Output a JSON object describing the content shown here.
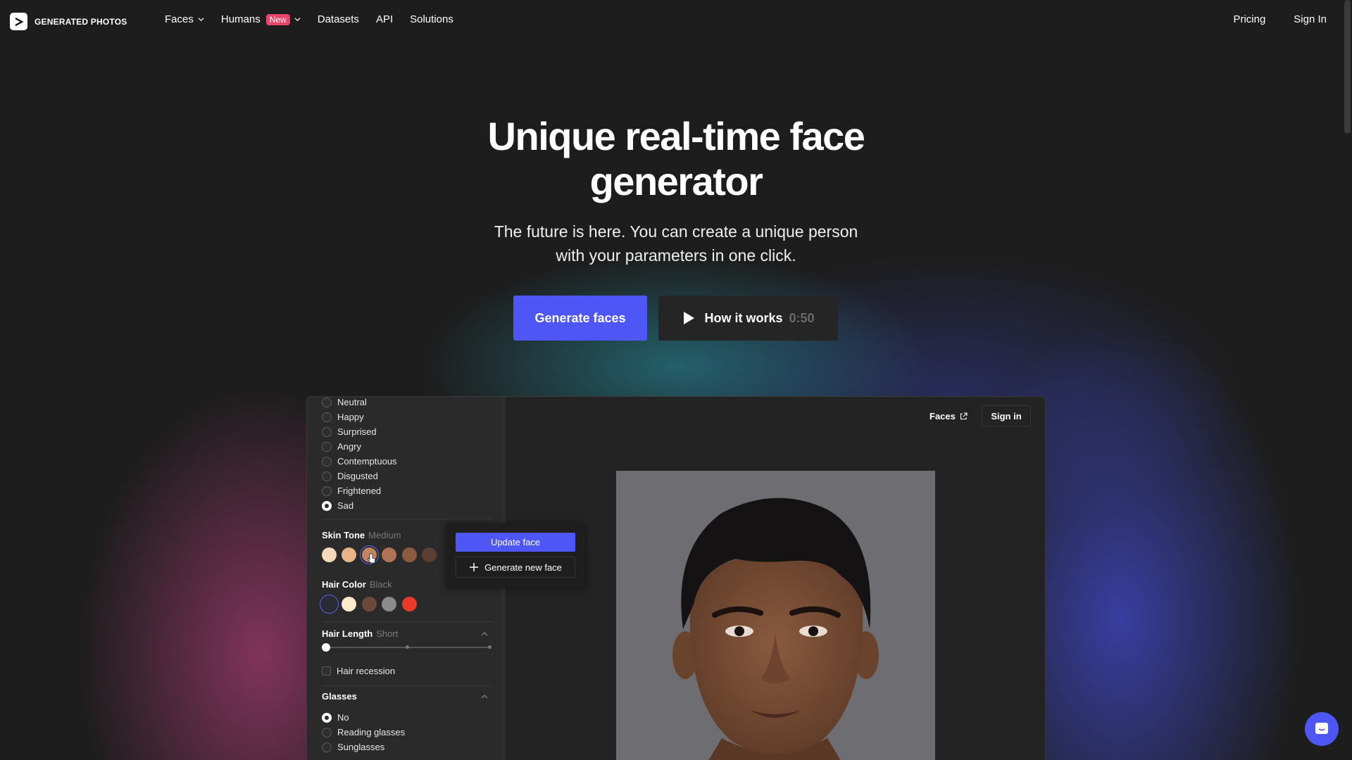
{
  "nav": {
    "brand": "GENERATED PHOTOS",
    "links": [
      {
        "label": "Faces",
        "dropdown": true
      },
      {
        "label": "Humans",
        "badge": "New",
        "dropdown": true
      },
      {
        "label": "Datasets"
      },
      {
        "label": "API"
      },
      {
        "label": "Solutions"
      }
    ],
    "pricing": "Pricing",
    "sign_in": "Sign In"
  },
  "hero": {
    "title_line1": "Unique real-time face",
    "title_line2": "generator",
    "subtitle_line1": "The future is here. You can create a unique person",
    "subtitle_line2": "with your parameters in one click.",
    "cta_primary": "Generate faces",
    "cta_secondary": "How it works",
    "video_duration": "0:50"
  },
  "app": {
    "emotions": [
      {
        "label": "Neutral",
        "selected": false
      },
      {
        "label": "Happy",
        "selected": false
      },
      {
        "label": "Surprised",
        "selected": false
      },
      {
        "label": "Angry",
        "selected": false
      },
      {
        "label": "Contemptuous",
        "selected": false
      },
      {
        "label": "Disgusted",
        "selected": false
      },
      {
        "label": "Frightened",
        "selected": false
      },
      {
        "label": "Sad",
        "selected": true
      }
    ],
    "skin_tone": {
      "label": "Skin Tone",
      "value": "Medium",
      "colors": [
        "#f3d9b8",
        "#e8b487",
        "#c38462",
        "#b07356",
        "#8d5a40",
        "#5c3f34"
      ],
      "selected_index": 2
    },
    "hair_color": {
      "label": "Hair Color",
      "value": "Black",
      "colors": [
        "#2b2b33",
        "#fbeacb",
        "#6b4a3c",
        "#8a8a8a",
        "#e8392b"
      ],
      "selected_index": 0
    },
    "hair_length": {
      "label": "Hair Length",
      "value": "Short",
      "level": 0
    },
    "hair_recession": "Hair recession",
    "glasses": {
      "label": "Glasses",
      "options": [
        {
          "label": "No",
          "selected": true
        },
        {
          "label": "Reading glasses",
          "selected": false
        },
        {
          "label": "Sunglasses",
          "selected": false
        }
      ]
    },
    "popup": {
      "update": "Update face",
      "new": "Generate new face"
    },
    "header": {
      "faces": "Faces",
      "sign_in": "Sign in"
    }
  },
  "colors": {
    "accent": "#4e56f5",
    "badge": "#e9456c",
    "background": "#1d1d1d"
  }
}
